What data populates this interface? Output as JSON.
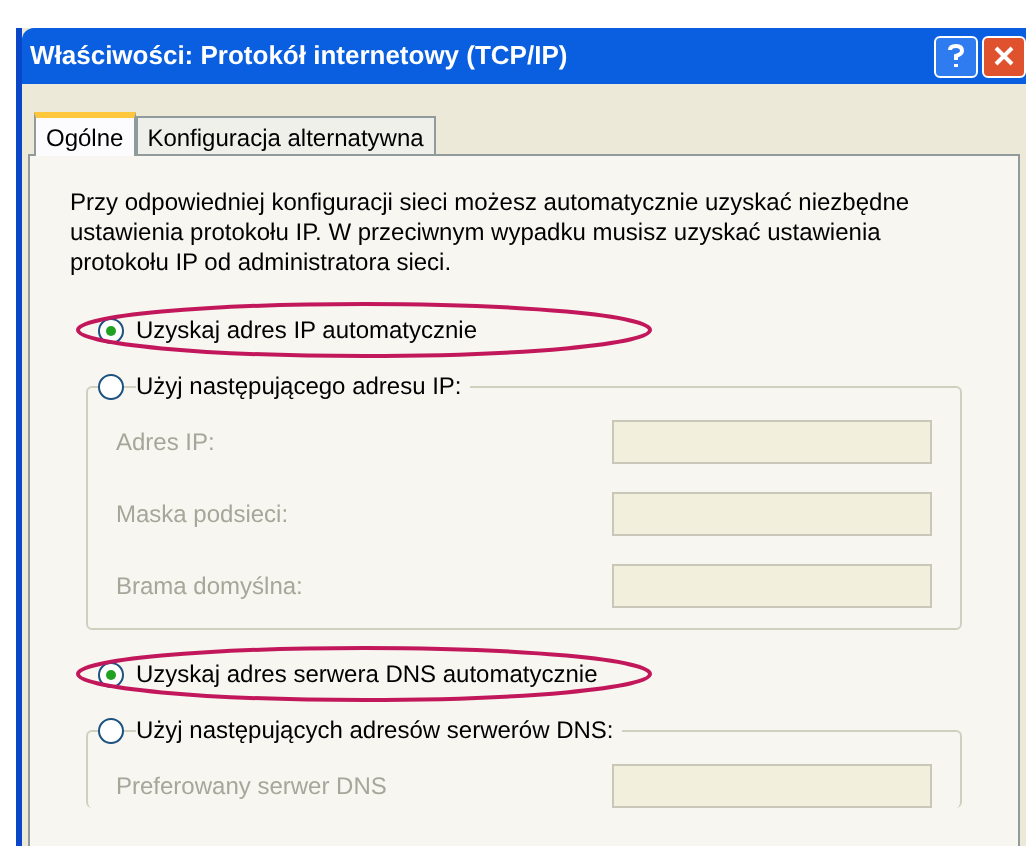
{
  "window": {
    "title": "Właściwości: Protokół internetowy (TCP/IP)"
  },
  "tabs": [
    {
      "label": "Ogólne",
      "selected": true
    },
    {
      "label": "Konfiguracja alternatywna",
      "selected": false
    }
  ],
  "description": "Przy odpowiedniej konfiguracji sieci możesz automatycznie uzyskać niezbędne ustawienia protokołu IP. W przeciwnym wypadku musisz uzyskać ustawienia protokołu IP od administratora sieci.",
  "sections": [
    {
      "auto": {
        "label": "Uzyskaj adres IP automatycznie",
        "selected": true,
        "highlighted": true
      },
      "manual": {
        "label": "Użyj następującego adresu IP:",
        "selected": false
      },
      "fields": [
        {
          "label": "Adres IP:",
          "disabled": true
        },
        {
          "label": "Maska podsieci:",
          "disabled": true
        },
        {
          "label": "Brama domyślna:",
          "disabled": true
        }
      ]
    },
    {
      "auto": {
        "label": "Uzyskaj adres serwera DNS automatycznie",
        "selected": true,
        "highlighted": true
      },
      "manual": {
        "label": "Użyj następujących adresów serwerów DNS:",
        "selected": false
      },
      "fields": [
        {
          "label": "Preferowany serwer DNS",
          "disabled": true
        }
      ]
    }
  ]
}
